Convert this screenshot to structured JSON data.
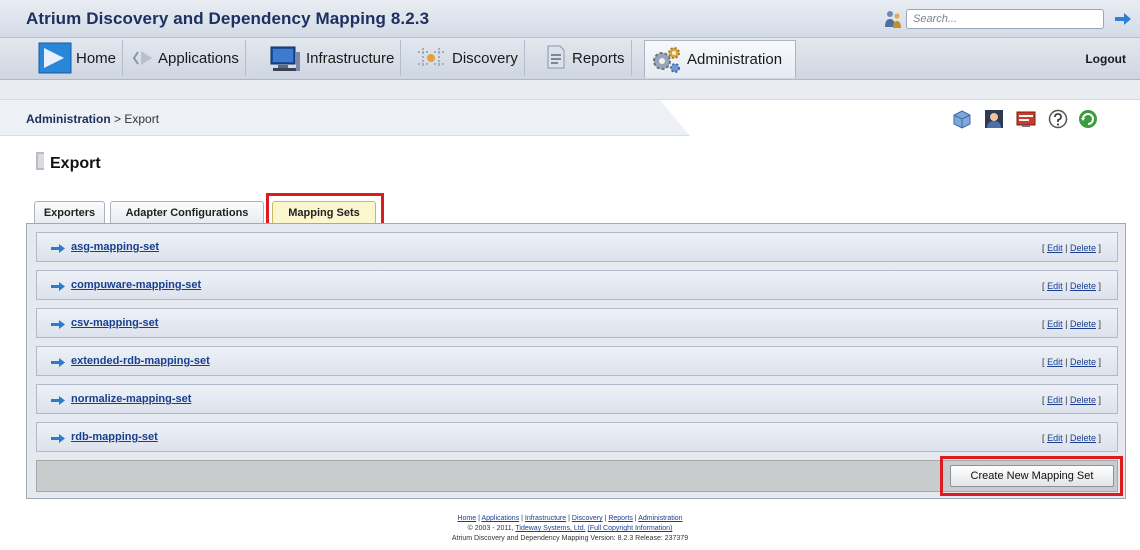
{
  "app": {
    "title": "Atrium Discovery and Dependency Mapping 8.2.3",
    "search_placeholder": "Search..."
  },
  "nav": {
    "items": [
      {
        "label": "Home",
        "icon": "home-arrow-icon"
      },
      {
        "label": "Applications",
        "icon": "applications-icon"
      },
      {
        "label": "Infrastructure",
        "icon": "infrastructure-icon"
      },
      {
        "label": "Discovery",
        "icon": "discovery-icon"
      },
      {
        "label": "Reports",
        "icon": "reports-icon"
      },
      {
        "label": "Administration",
        "icon": "administration-gears-icon"
      }
    ],
    "active": "Administration",
    "logout_label": "Logout"
  },
  "breadcrumb": {
    "parent": "Administration",
    "separator": " > ",
    "current": "Export"
  },
  "toolbar_icons": [
    "cube-icon",
    "user-icon",
    "screen-icon",
    "help-icon",
    "refresh-icon"
  ],
  "page": {
    "title": "Export"
  },
  "tabs": [
    {
      "label": "Exporters",
      "active": false
    },
    {
      "label": "Adapter Configurations",
      "active": false
    },
    {
      "label": "Mapping Sets",
      "active": true
    }
  ],
  "mapping_sets": [
    {
      "name": "asg-mapping-set"
    },
    {
      "name": "compuware-mapping-set"
    },
    {
      "name": "csv-mapping-set"
    },
    {
      "name": "extended-rdb-mapping-set"
    },
    {
      "name": "normalize-mapping-set"
    },
    {
      "name": "rdb-mapping-set"
    }
  ],
  "row_actions": {
    "open": "[",
    "edit": "Edit",
    "sep": "|",
    "delete": "Delete",
    "close": "]"
  },
  "create_button_label": "Create New Mapping Set",
  "footer": {
    "links": [
      "Home",
      "Applications",
      "Infrastructure",
      "Discovery",
      "Reports",
      "Administration"
    ],
    "link_separator": " | ",
    "copyright_prefix": "© 2003 - 2011, ",
    "company_link": "Tideway Systems, Ltd.",
    "copyright_info_link": "(Full Copyright Information)",
    "version_line": "Atrium Discovery and Dependency Mapping Version: 8.2.3 Release: 237379"
  },
  "colors": {
    "highlight": "#dd1d1d",
    "link": "#1a3f8f",
    "active_tab": "#fcf6cf",
    "title": "#1e3060"
  }
}
